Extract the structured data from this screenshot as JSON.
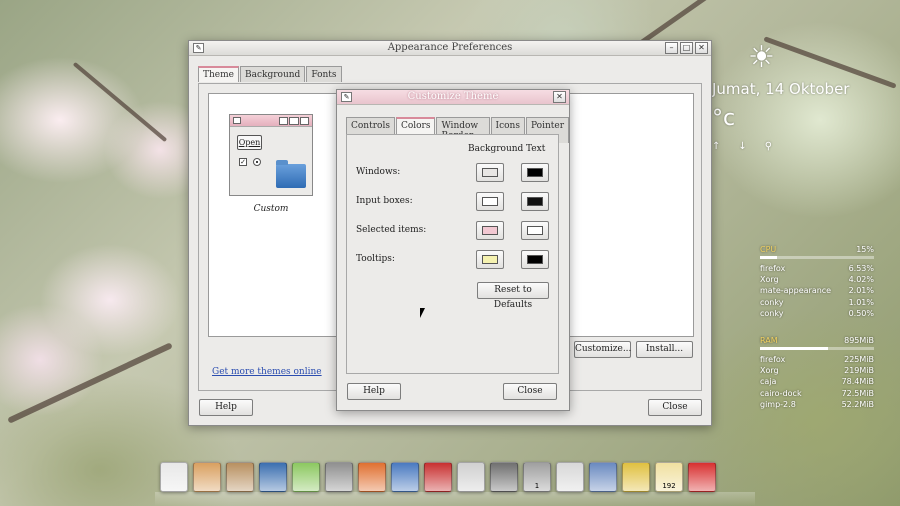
{
  "desktop": {
    "date": "Jumat, 14 Oktober",
    "temp": "°c",
    "weather_icon": "sun-cloud-icon",
    "icons": [
      "↑",
      "↓",
      "⚲"
    ]
  },
  "sysmon": {
    "cpu": {
      "label": "CPU",
      "value": "15%",
      "level": 0.15,
      "procs": [
        {
          "name": "firefox",
          "value": "6.53%"
        },
        {
          "name": "Xorg",
          "value": "4.02%"
        },
        {
          "name": "mate-appearance",
          "value": "2.01%"
        },
        {
          "name": "conky",
          "value": "1.01%"
        },
        {
          "name": "conky",
          "value": "0.50%"
        }
      ]
    },
    "ram": {
      "label": "RAM",
      "value": "895MiB",
      "level": 0.6,
      "procs": [
        {
          "name": "firefox",
          "value": "225MiB"
        },
        {
          "name": "Xorg",
          "value": "219MiB"
        },
        {
          "name": "caja",
          "value": "78.4MiB"
        },
        {
          "name": "cairo-dock",
          "value": "72.5MiB"
        },
        {
          "name": "gimp-2.8",
          "value": "52.2MiB"
        }
      ]
    }
  },
  "appearance": {
    "title": "Appearance Preferences",
    "tabs": [
      "Theme",
      "Background",
      "Fonts"
    ],
    "active_tab": 0,
    "theme_name": "Custom",
    "preview_open": "Open",
    "get_more": "Get more themes online",
    "customize": "Customize...",
    "install": "Install...",
    "help": "Help",
    "close": "Close"
  },
  "customize": {
    "title": "Customize Theme",
    "tabs": [
      "Controls",
      "Colors",
      "Window Border",
      "Icons",
      "Pointer"
    ],
    "active_tab": 1,
    "col_background": "Background",
    "col_text": "Text",
    "rows": [
      {
        "label": "Windows:",
        "bg": "#e8e6e4",
        "text": "#000000"
      },
      {
        "label": "Input boxes:",
        "bg": "#ffffff",
        "text": "#111111"
      },
      {
        "label": "Selected items:",
        "bg": "#f2c8d2",
        "text": "#ffffff"
      },
      {
        "label": "Tooltips:",
        "bg": "#f5f2b0",
        "text": "#000000"
      }
    ],
    "reset": "Reset to Defaults",
    "help": "Help",
    "close": "Close"
  },
  "dock": {
    "items": [
      {
        "name": "calendar-icon",
        "color": "#e8e8e8",
        "badge": ""
      },
      {
        "name": "paint-icon",
        "color": "#d9a060",
        "badge": ""
      },
      {
        "name": "settings-icon",
        "color": "#b89060",
        "badge": ""
      },
      {
        "name": "writer-icon",
        "color": "#3b6fb0",
        "badge": ""
      },
      {
        "name": "mint-icon",
        "color": "#8cc860",
        "badge": ""
      },
      {
        "name": "system-icon",
        "color": "#909090",
        "badge": ""
      },
      {
        "name": "firefox-icon",
        "color": "#e07030",
        "badge": ""
      },
      {
        "name": "window-icon",
        "color": "#4a7ac0",
        "badge": ""
      },
      {
        "name": "game-icon",
        "color": "#c83030",
        "badge": ""
      },
      {
        "name": "office-icon",
        "color": "#d0d0d0",
        "badge": ""
      },
      {
        "name": "suit-icon",
        "color": "#707070",
        "badge": ""
      },
      {
        "name": "gimp-icon",
        "color": "#a0a0a0",
        "badge": "1"
      },
      {
        "name": "search-icon",
        "color": "#d8d8d8",
        "badge": ""
      },
      {
        "name": "folder-icon",
        "color": "#6a8ac0",
        "badge": ""
      },
      {
        "name": "monitor-icon",
        "color": "#e0c040",
        "badge": ""
      },
      {
        "name": "update-icon",
        "color": "#f0e0a0",
        "badge": "192"
      },
      {
        "name": "power-icon",
        "color": "#d83030",
        "badge": ""
      }
    ]
  }
}
